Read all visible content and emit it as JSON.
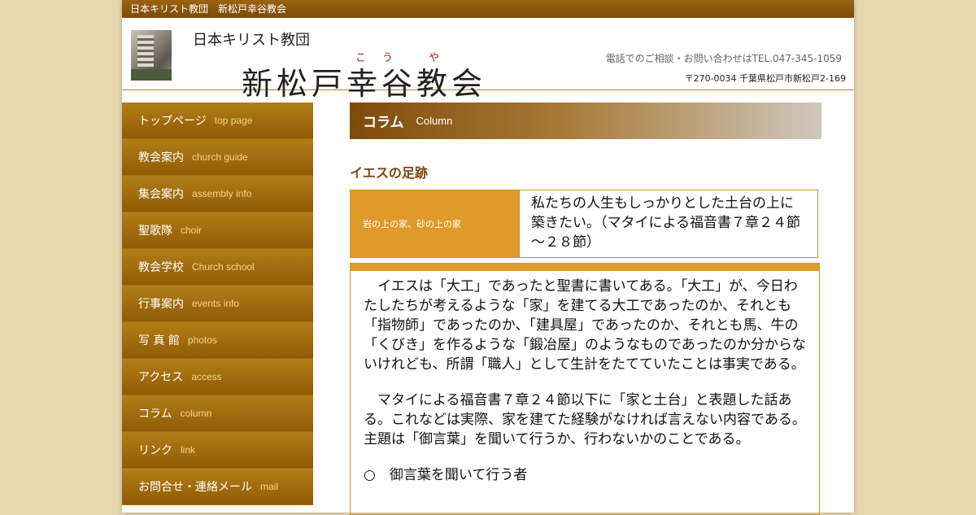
{
  "topbar": {
    "title": "日本キリスト教団　新松戸幸谷教会"
  },
  "header": {
    "org": "日本キリスト教団",
    "ruby": "こう や",
    "church": "新松戸幸谷教会",
    "contact": "電話でのご相談・お問い合わせはTEL.047-345-1059",
    "address": "〒270-0034 千葉県松戸市新松戸2-169"
  },
  "nav": {
    "items": [
      {
        "ja": "トップページ",
        "en": "top page"
      },
      {
        "ja": "教会案内",
        "en": "church guide"
      },
      {
        "ja": "集会案内",
        "en": "assembly info"
      },
      {
        "ja": "聖歌隊",
        "en": "choir"
      },
      {
        "ja": "教会学校",
        "en": "Church school"
      },
      {
        "ja": "行事案内",
        "en": "events info"
      },
      {
        "ja": "写 真 館",
        "en": "photos"
      },
      {
        "ja": "アクセス",
        "en": "access"
      },
      {
        "ja": "コラム",
        "en": "column"
      },
      {
        "ja": "リンク",
        "en": "link"
      },
      {
        "ja": "お問合せ・連絡メール",
        "en": "mail"
      }
    ]
  },
  "main": {
    "section_ja": "コラム",
    "section_en": "Column",
    "article_title": "イエスの足跡",
    "info_label": "岩の上の家、砂の上の家",
    "info_quote": "私たちの人生もしっかりとした土台の上に築きたい。（マタイによる福音書７章２４節～２８節）",
    "paragraphs": [
      "　イエスは「大工」であったと聖書に書いてある。「大工」が、今日わたしたちが考えるような「家」を建てる大工であったのか、それとも「指物師」であったのか、「建具屋」であったのか、それとも馬、牛の「くびき」を作るような「鍛冶屋」のようなものであったのか分からないけれども、所謂「職人」として生計をたてていたことは事実である。",
      "　マタイによる福音書７章２４節以下に「家と土台」と表題した話ある。これなどは実際、家を建てた経験がなければ言えない内容である。主題は「御言葉」を聞いて行うか、行わないかのことである。",
      "○　御言葉を聞いて行う者"
    ]
  },
  "colors": {
    "brand": "#8f5c06",
    "accent": "#df9a2a",
    "page_bg": "#e8d8b0"
  }
}
